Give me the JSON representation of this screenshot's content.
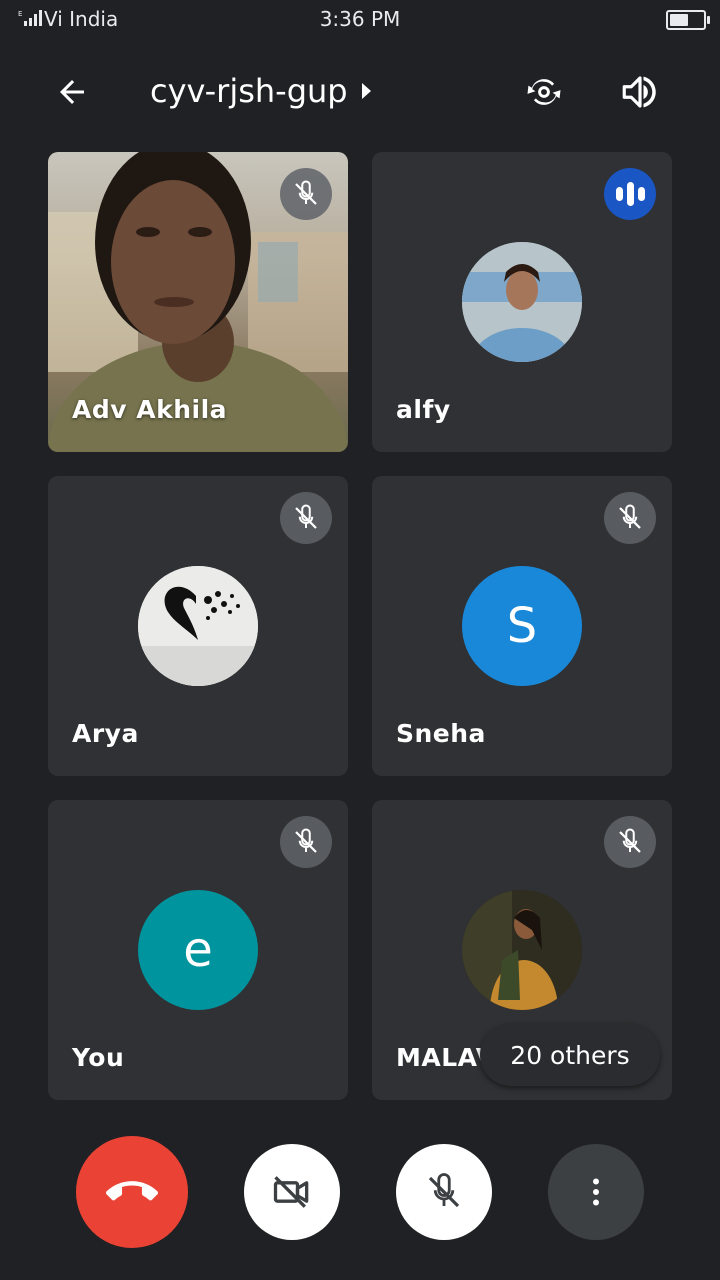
{
  "status": {
    "carrier": "Vi India",
    "time": "3:36 PM",
    "battery_level": 0.5
  },
  "meeting": {
    "title": "cyv-rjsh-gup"
  },
  "participants": [
    {
      "name": "Adv Akhila",
      "muted": true,
      "video": true
    },
    {
      "name": "alfy",
      "muted": false,
      "speaking": true
    },
    {
      "name": "Arya",
      "muted": true
    },
    {
      "name": "Sneha",
      "muted": true,
      "initial": "S",
      "color": "#1a88d8"
    },
    {
      "name": "You",
      "muted": true,
      "initial": "e",
      "color": "#00949e"
    },
    {
      "name": "MALAVIKA",
      "muted": true
    }
  ],
  "others": {
    "label": "20 others"
  },
  "colors": {
    "end_call": "#ea4335",
    "background": "#202124",
    "tile": "#303134",
    "speaking": "#1a56c4"
  },
  "icons": [
    "arrow-left-icon",
    "switch-camera-icon",
    "speaker-icon",
    "mic-off-icon",
    "speaking-icon",
    "end-call-icon",
    "camera-off-icon",
    "more-vert-icon"
  ]
}
